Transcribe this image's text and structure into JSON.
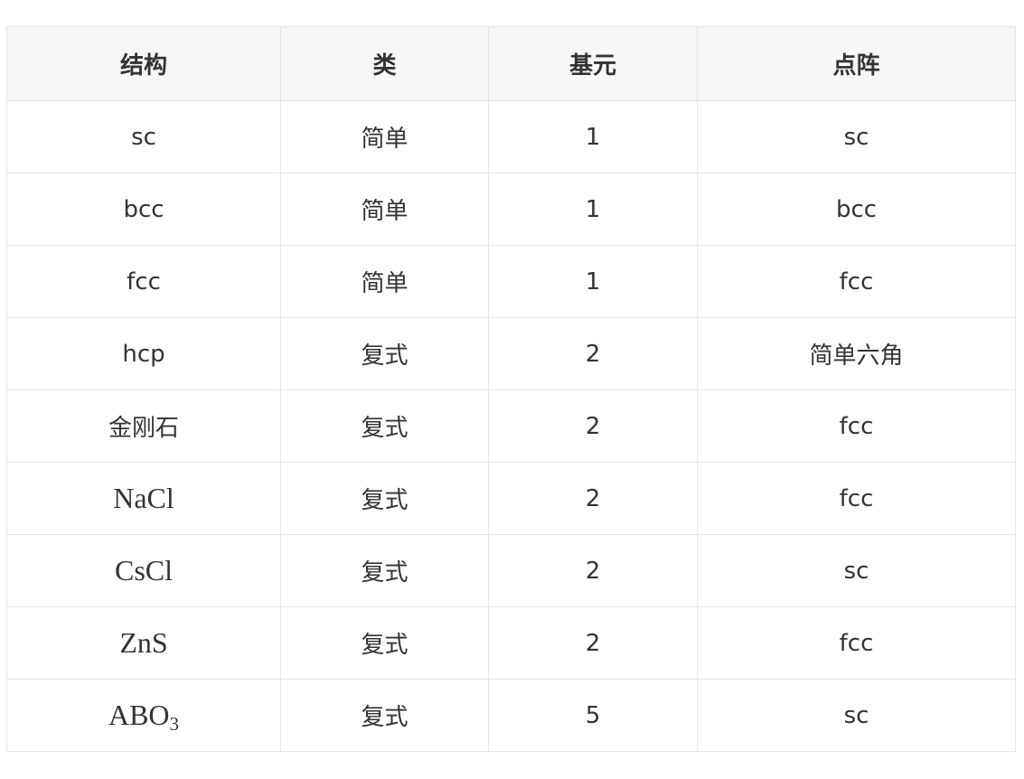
{
  "table": {
    "headers": [
      "结构",
      "类",
      "基元",
      "点阵"
    ],
    "rows": [
      {
        "structure": "sc",
        "type": "简单",
        "basis": "1",
        "lattice": "sc"
      },
      {
        "structure": "bcc",
        "type": "简单",
        "basis": "1",
        "lattice": "bcc"
      },
      {
        "structure": "fcc",
        "type": "简单",
        "basis": "1",
        "lattice": "fcc"
      },
      {
        "structure": "hcp",
        "type": "复式",
        "basis": "2",
        "lattice": "简单六角"
      },
      {
        "structure": "金刚石",
        "type": "复式",
        "basis": "2",
        "lattice": "fcc"
      },
      {
        "structure": "NaCl",
        "type": "复式",
        "basis": "2",
        "lattice": "fcc"
      },
      {
        "structure": "CsCl",
        "type": "复式",
        "basis": "2",
        "lattice": "sc"
      },
      {
        "structure": "ZnS",
        "type": "复式",
        "basis": "2",
        "lattice": "fcc"
      },
      {
        "structure": "ABO",
        "structure_sub": "3",
        "type": "复式",
        "basis": "5",
        "lattice": "sc"
      }
    ]
  }
}
